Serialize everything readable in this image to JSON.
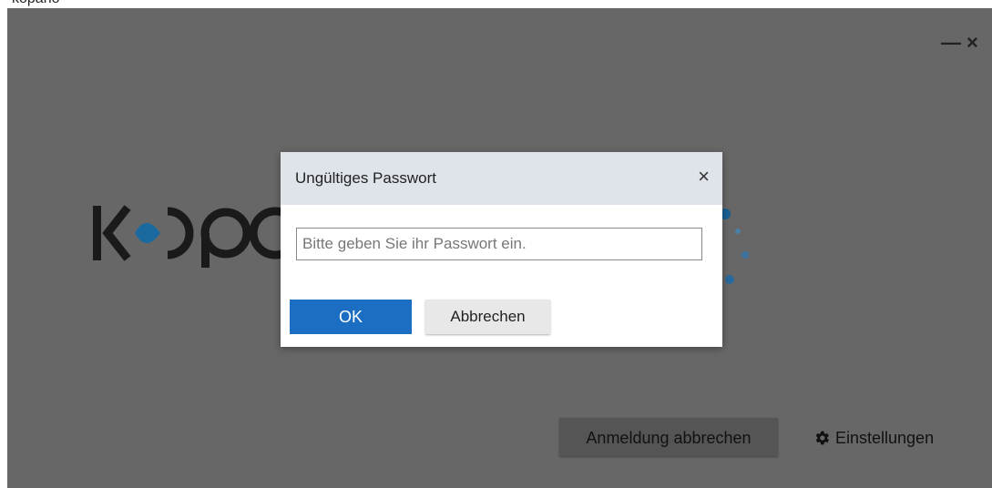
{
  "top_fragment": "kopano",
  "window_controls": {
    "minimize_glyph": "—",
    "close_glyph": "×"
  },
  "background_actions": {
    "cancel_login_label": "Anmeldung abbrechen",
    "settings_label": "Einstellungen",
    "settings_icon": "gear-icon"
  },
  "dialog": {
    "title": "Ungültiges Passwort",
    "close_glyph": "×",
    "password_value": "",
    "password_placeholder": "Bitte geben Sie ihr Passwort ein.",
    "ok_label": "OK",
    "cancel_label": "Abbrechen"
  },
  "colors": {
    "overlay": "#676767",
    "accent": "#1b6ec2",
    "dialog_header": "#dfe3ea"
  }
}
